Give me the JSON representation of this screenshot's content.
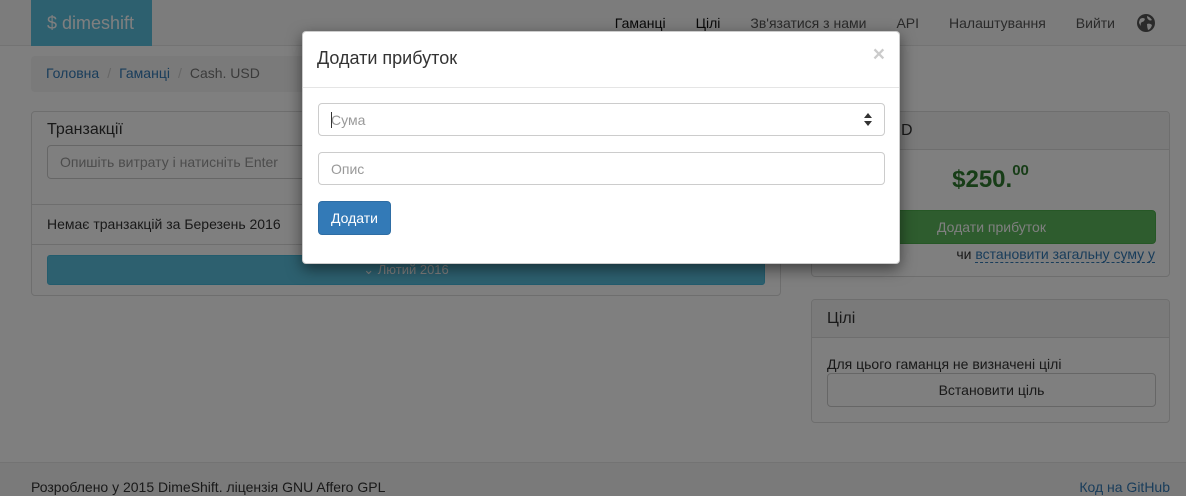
{
  "navbar": {
    "brand": "$ dimeshift",
    "links": [
      "Гаманці",
      "Цілі",
      "Зв'язатися з нами",
      "API",
      "Налаштування",
      "Вийти"
    ],
    "globe_icon": "globe-icon"
  },
  "breadcrumb": {
    "items": [
      "Головна",
      "Гаманці"
    ],
    "current": "Cash. USD",
    "separator": "/"
  },
  "transactions": {
    "title": "Транзакції",
    "input_placeholder": "Опишіть витрату і натисніть Enter",
    "empty_text": "Немає транзакцій за Березень 2016",
    "prev_month_label": "Лютий 2016"
  },
  "wallet": {
    "title_visible": "D",
    "balance_main": "$250.",
    "balance_cents": "00",
    "add_income_label": "Додати прибуток",
    "or_text": "чи ",
    "set_total_link": "встановити загальну суму у"
  },
  "goals": {
    "title": "Цілі",
    "none_text": "Для цього гаманця не визначені цілі",
    "set_goal_label": "Встановити ціль"
  },
  "footer": {
    "text": "Розроблено у 2015 DimeShift. ліцензія GNU Affero GPL",
    "github_link": "Код на GitHub"
  },
  "modal": {
    "title": "Додати прибуток",
    "close_symbol": "×",
    "amount_placeholder": "Сума",
    "description_placeholder": "Опис",
    "submit_label": "Додати"
  },
  "colors": {
    "brand": "#5bc0de",
    "primary": "#337ab7",
    "success": "#5cb85c",
    "balance": "#2f7a2f"
  }
}
